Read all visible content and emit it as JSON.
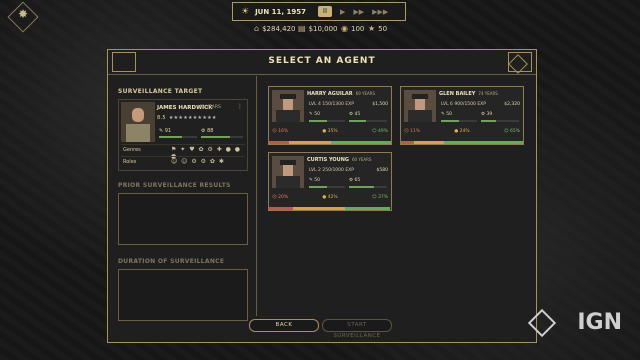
{
  "hud": {
    "date": "JUN 11, 1957",
    "pause_label": "II",
    "speed1": "▶",
    "speed2": "▶▶",
    "speed3": "▶▶▶",
    "money": "$284,420",
    "money2": "$10,000",
    "res3": "100",
    "res4": "50"
  },
  "dialog": {
    "title": "SELECT AN AGENT",
    "surveillance_target_label": "SURVEILLANCE TARGET",
    "prior_results_label": "PRIOR SURVEILLANCE RESULTS",
    "duration_label": "DURATION OF SURVEILLANCE",
    "back_button": "BACK",
    "start_button": "START SURVEILLANCE"
  },
  "target": {
    "name": "JAMES HARDWICK",
    "age": "42 YEARS",
    "level": "8.5",
    "stars": "★★★★★★★★★★",
    "stat1": "91",
    "stat2": "88",
    "stat1_fill": 0.6,
    "stat2_fill": 0.7,
    "genres_label": "Genres",
    "genres_icons": "⚑ ✦ ♥ ✿ ⚙ ✚ ● ● ●",
    "roles_label": "Roles",
    "roles_icons": "☺ ☺ ⚙ ⚙ ✿ ✱"
  },
  "agents": [
    {
      "name": "HARRY AGUILAR",
      "age": "69 YEARS",
      "level": "LVL 4",
      "exp": "150/1300 EXP",
      "cost": "$1,500",
      "s1": "50",
      "s2": "45",
      "s1_fill": 0.5,
      "s2_fill": 0.45,
      "p1": "16%",
      "p2": "35%",
      "p3": "49%"
    },
    {
      "name": "GLEN BAILEY",
      "age": "74 YEARS",
      "level": "LVL 6",
      "exp": "900/1500 EXP",
      "cost": "$2,320",
      "s1": "50",
      "s2": "39",
      "s1_fill": 0.5,
      "s2_fill": 0.39,
      "p1": "11%",
      "p2": "24%",
      "p3": "65%"
    },
    {
      "name": "CURTIS YOUNG",
      "age": "60 YEARS",
      "level": "LVL 2",
      "exp": "250/1000 EXP",
      "cost": "$580",
      "s1": "50",
      "s2": "65",
      "s1_fill": 0.5,
      "s2_fill": 0.65,
      "p1": "20%",
      "p2": "42%",
      "p3": "37%"
    }
  ],
  "watermark": "IGN"
}
